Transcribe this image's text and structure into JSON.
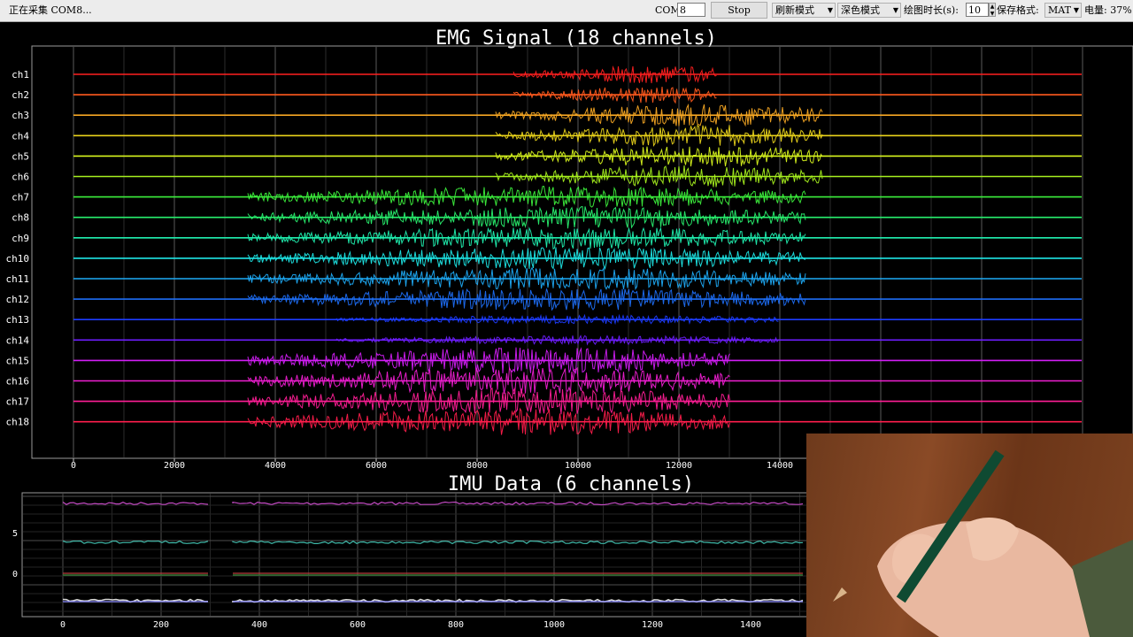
{
  "toolbar": {
    "status": "正在采集 COM8...",
    "com_label": "COM:",
    "com_value": "8",
    "stop_label": "Stop",
    "refresh_mode": "刷新模式",
    "theme_mode": "深色模式",
    "plot_duration_label": "绘图时长(s):",
    "plot_duration_value": "10",
    "save_format_label": "保存格式:",
    "save_format_value": "MAT",
    "battery": "电量: 37%"
  },
  "emg": {
    "title": "EMG Signal (18 channels)",
    "channels": [
      "ch1",
      "ch2",
      "ch3",
      "ch4",
      "ch5",
      "ch6",
      "ch7",
      "ch8",
      "ch9",
      "ch10",
      "ch11",
      "ch12",
      "ch13",
      "ch14",
      "ch15",
      "ch16",
      "ch17",
      "ch18"
    ],
    "colors": [
      "#ff2020",
      "#ff5a1e",
      "#f5a623",
      "#e8d21a",
      "#d8f51e",
      "#a6f01e",
      "#3cf03c",
      "#28f06e",
      "#20f0b0",
      "#1ee6e6",
      "#1eaaf5",
      "#1e6ef5",
      "#1e3cff",
      "#6e1eff",
      "#d21ef5",
      "#f01ed2",
      "#ff1e96",
      "#ff1e4c"
    ],
    "x_ticks": [
      "0",
      "2000",
      "4000",
      "6000",
      "8000",
      "10000",
      "12000",
      "14000"
    ]
  },
  "imu": {
    "title": "IMU Data (6 channels)",
    "y_ticks": [
      "5",
      "0"
    ],
    "x_ticks": [
      "0",
      "200",
      "400",
      "600",
      "800",
      "1000",
      "1200",
      "1400"
    ]
  },
  "icons": {
    "dropdown": "chevron-down-icon",
    "spinner": "spinner-arrows-icon"
  }
}
